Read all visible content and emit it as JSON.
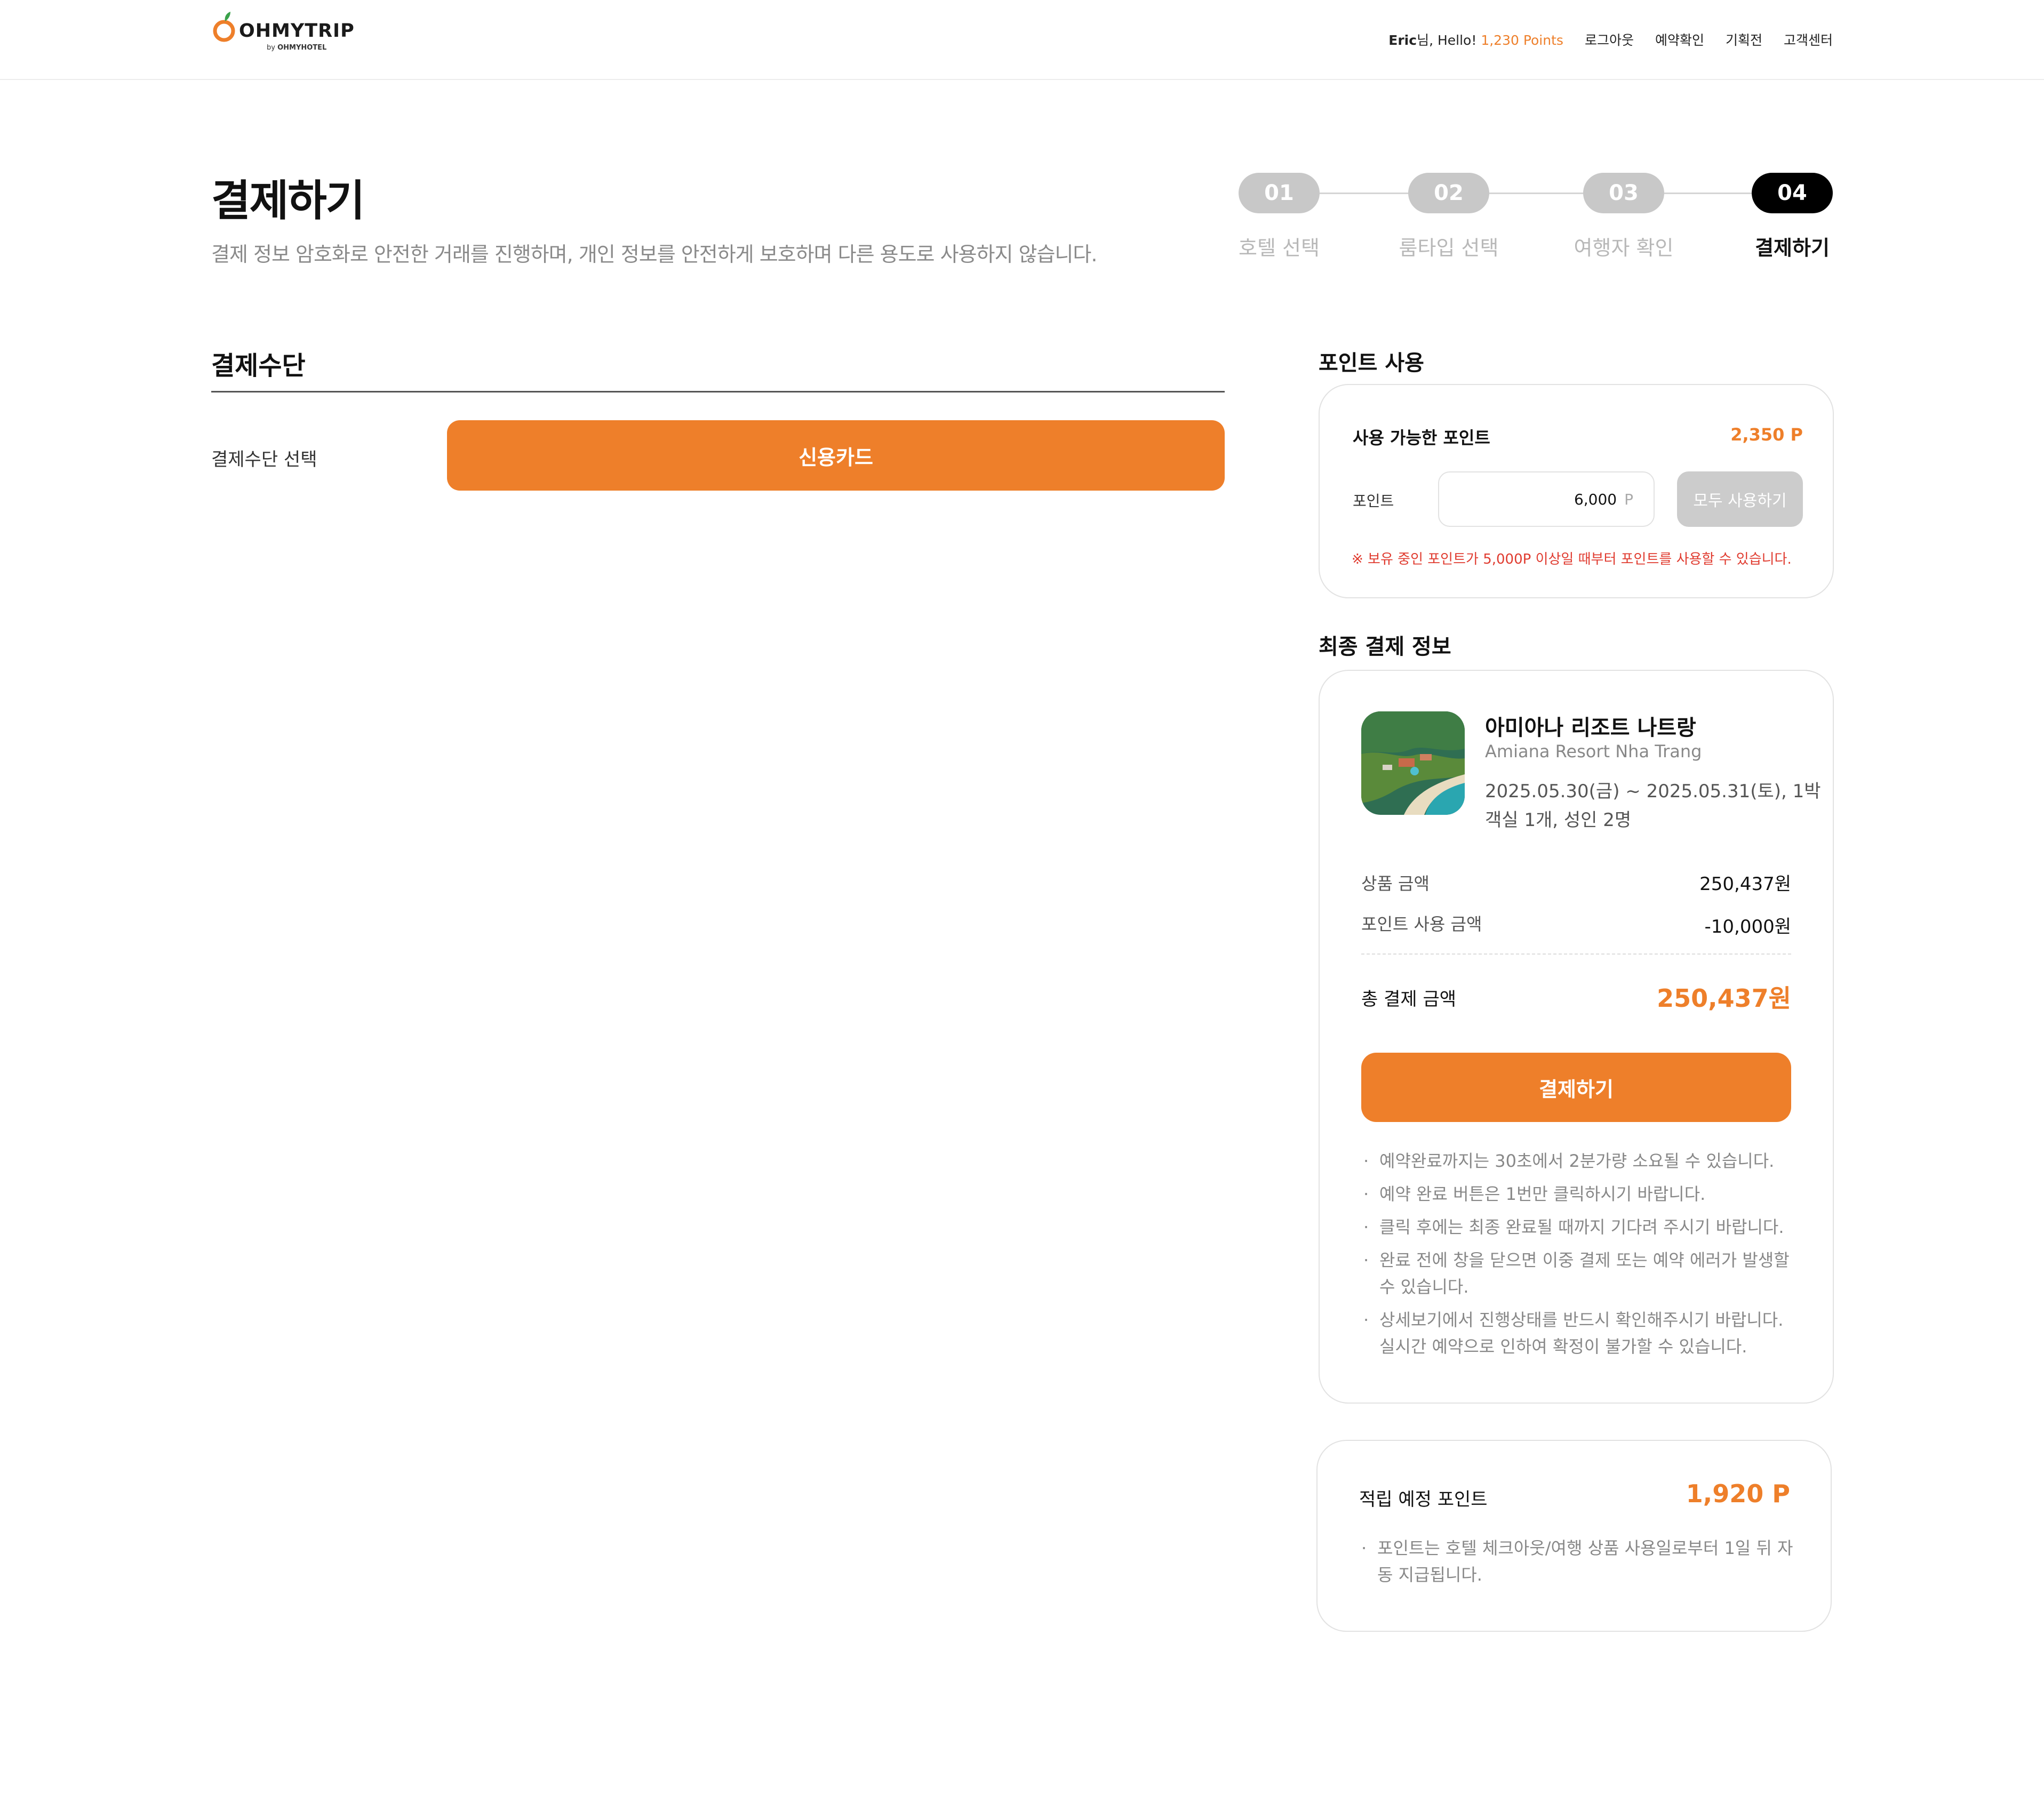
{
  "header": {
    "logo_main": "OHMYTRIP",
    "logo_by": "by",
    "logo_brand": "OHMYHOTEL",
    "user_name": "Eric",
    "greeting_suffix": "님, Hello!",
    "points_text": "1,230 Points",
    "nav": [
      "로그아웃",
      "예약확인",
      "기획전",
      "고객센터"
    ]
  },
  "page": {
    "title": "결제하기",
    "description": "결제 정보 암호화로 안전한 거래를 진행하며, 개인 정보를 안전하게 보호하며 다른 용도로 사용하지 않습니다."
  },
  "steps": [
    {
      "num": "01",
      "label": "호텔 선택",
      "active": false
    },
    {
      "num": "02",
      "label": "룸타입 선택",
      "active": false
    },
    {
      "num": "03",
      "label": "여행자 확인",
      "active": false
    },
    {
      "num": "04",
      "label": "결제하기",
      "active": true
    }
  ],
  "payment_method": {
    "section_title": "결제수단",
    "label": "결제수단 선택",
    "selected_option": "신용카드"
  },
  "points": {
    "section_title": "포인트 사용",
    "available_label": "사용 가능한 포인트",
    "available_value": "2,350 P",
    "input_label": "포인트",
    "input_value": "6,000",
    "input_unit": "P",
    "use_all_button": "모두 사용하기",
    "note": "※ 보유 중인 포인트가 5,000P 이상일 때부터 포인트를 사용할 수 있습니다."
  },
  "final_payment": {
    "section_title": "최종 결제 정보",
    "hotel_name_ko": "아미아나 리조트 나트랑",
    "hotel_name_en": "Amiana Resort Nha Trang",
    "dates": "2025.05.30(금) ~ 2025.05.31(토), 1박",
    "room_info": "객실 1개, 성인 2명",
    "product_price_label": "상품 금액",
    "product_price_value": "250,437원",
    "point_discount_label": "포인트 사용 금액",
    "point_discount_value": "-10,000원",
    "total_label": "총 결제 금액",
    "total_value": "250,437원",
    "pay_button": "결제하기",
    "notes": [
      "예약완료까지는 30초에서 2분가량 소요될 수 있습니다.",
      "예약 완료 버튼은 1번만 클릭하시기 바랍니다.",
      "클릭 후에는 최종 완료될 때까지 기다려 주시기 바랍니다.",
      "완료 전에 창을 닫으면 이중 결제 또는 예약 에러가 발생할 수 있습니다.",
      "상세보기에서 진행상태를 반드시 확인해주시기 바랍니다. 실시간 예약으로 인하여 확정이 불가할 수 있습니다."
    ]
  },
  "earn_points": {
    "label": "적립 예정 포인트",
    "value": "1,920 P",
    "note": "포인트는 호텔 체크아웃/여행 상품 사용일로부터 1일 뒤 자동 지급됩니다."
  },
  "colors": {
    "accent": "#ee7f2a",
    "warning": "#e03b2f",
    "step_inactive": "#c8c8c8",
    "step_active": "#000000"
  }
}
